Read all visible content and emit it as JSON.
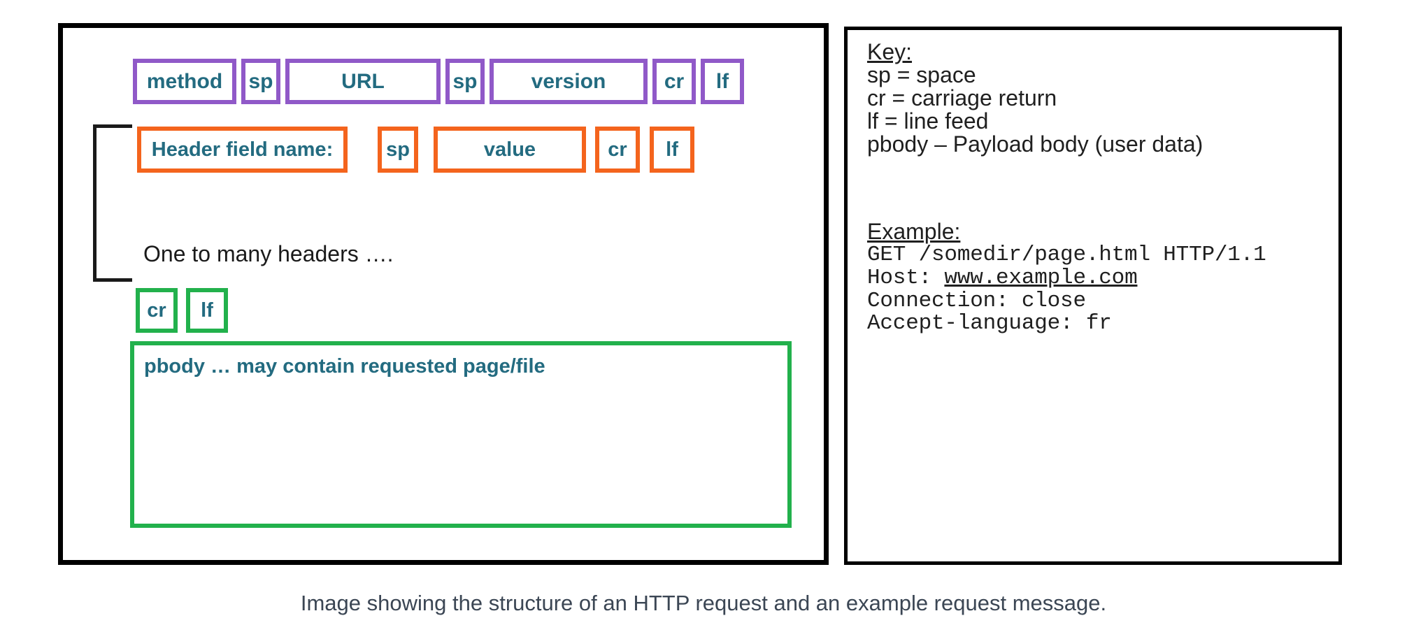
{
  "diagram": {
    "request_line": {
      "boxes": [
        {
          "label": "method",
          "color": "#9059c8"
        },
        {
          "label": "sp",
          "color": "#9059c8"
        },
        {
          "label": "URL",
          "color": "#9059c8"
        },
        {
          "label": "sp",
          "color": "#9059c8"
        },
        {
          "label": "version",
          "color": "#9059c8"
        },
        {
          "label": "cr",
          "color": "#9059c8"
        },
        {
          "label": "lf",
          "color": "#9059c8"
        }
      ]
    },
    "header_line": {
      "boxes": [
        {
          "label": "Header field name:",
          "color": "#f4641d"
        },
        {
          "label": "sp",
          "color": "#f4641d"
        },
        {
          "label": "value",
          "color": "#f4641d"
        },
        {
          "label": "cr",
          "color": "#f4641d"
        },
        {
          "label": "lf",
          "color": "#f4641d"
        }
      ]
    },
    "headers_note": "One to many headers ….",
    "blank_line": {
      "boxes": [
        {
          "label": "cr",
          "color": "#22b14c"
        },
        {
          "label": "lf",
          "color": "#22b14c"
        }
      ]
    },
    "payload": {
      "label": "pbody … may contain requested page/file",
      "color": "#22b14c"
    },
    "text_color": "#236b80"
  },
  "key_panel": {
    "key": {
      "heading": "Key:",
      "lines": [
        "sp = space",
        "cr = carriage return",
        "lf = line feed",
        "pbody – Payload body (user data)"
      ]
    },
    "example": {
      "heading": "Example:",
      "lines": [
        "GET /somedir/page.html HTTP/1.1",
        "Host: www.example.com",
        "Connection: close",
        "Accept-language: fr"
      ],
      "line1": "GET /somedir/page.html HTTP/1.1",
      "line2_prefix": "Host: ",
      "line2_link": "www.example.com",
      "line3": "Connection: close",
      "line4": "Accept-language: fr"
    }
  },
  "caption": "Image showing the structure of an HTTP request and an example request message."
}
